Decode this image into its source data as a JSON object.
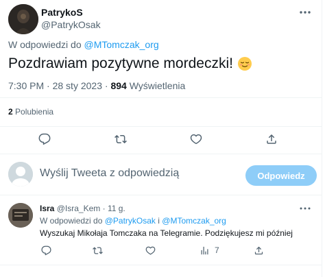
{
  "main_tweet": {
    "author_name": "PatrykoS",
    "author_handle": "@PatrykOsak",
    "reply_prefix": "W odpowiedzi do",
    "reply_handle": "@MTomczak_org",
    "text": "Pozdrawiam pozytywne mordeczki!",
    "emoji": "relieved-face-emoji",
    "time": "7:30 PM",
    "date": "28 sty 2023",
    "views_count": "894",
    "views_label": "Wyświetlenia",
    "likes_count": "2",
    "likes_label": "Polubienia"
  },
  "compose": {
    "placeholder": "Wyślij Tweeta z odpowiedzią",
    "reply_button": "Odpowiedz"
  },
  "reply_tweet": {
    "author_name": "Isra",
    "author_handle": "@Isra_Kem",
    "age": "11 g.",
    "reply_prefix": "W odpowiedzi do",
    "reply_handle_1": "@PatrykOsak",
    "reply_joiner": "i",
    "reply_handle_2": "@MTomczak_org",
    "text": "Wyszukaj Mikołaja Tomczaka na Telegramie. Podziękujesz mi później",
    "views": "7"
  },
  "colors": {
    "accent": "#1d9bf0",
    "secondary_text": "#536471",
    "divider": "#eff3f4",
    "reply_button_bg": "#8ecdf8"
  },
  "icons": [
    "more-icon",
    "reply-icon",
    "retweet-icon",
    "like-icon",
    "share-icon",
    "views-icon"
  ]
}
